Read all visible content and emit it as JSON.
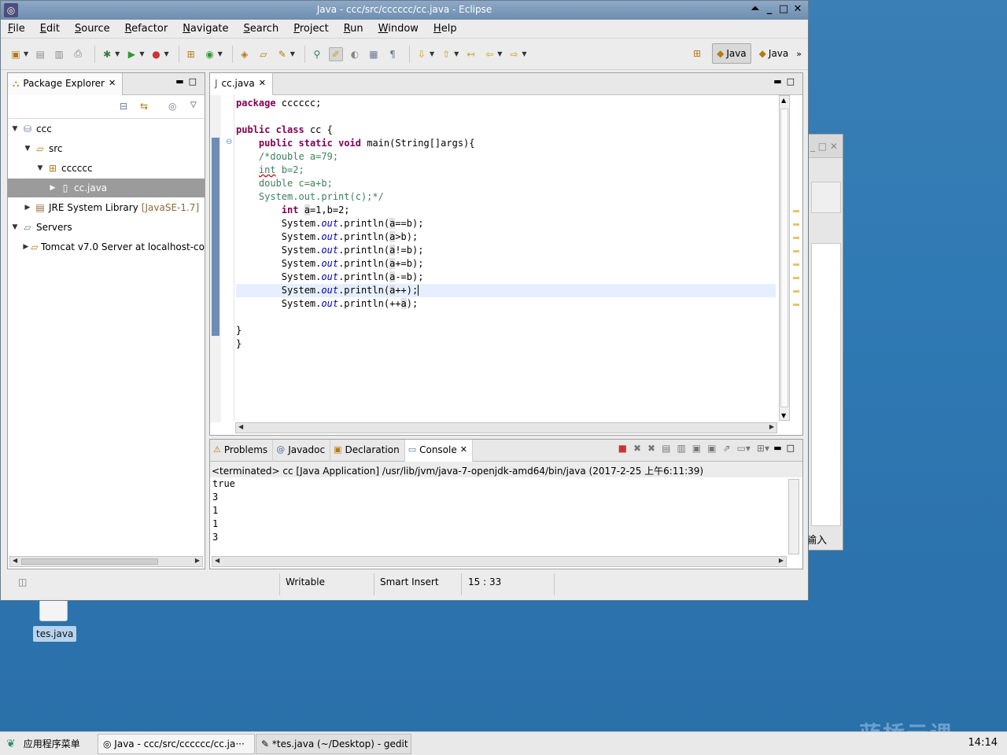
{
  "window": {
    "title": "Java - ccc/src/cccccc/cc.java - Eclipse"
  },
  "menu": [
    "File",
    "Edit",
    "Source",
    "Refactor",
    "Navigate",
    "Search",
    "Project",
    "Run",
    "Window",
    "Help"
  ],
  "perspectives": [
    {
      "label": "Java"
    },
    {
      "label": "Java"
    }
  ],
  "package_explorer": {
    "tab": "Package Explorer",
    "tree": [
      {
        "label": "ccc",
        "extra": "",
        "icon": "project-icon"
      },
      {
        "label": "src",
        "extra": "",
        "icon": "source-folder-icon"
      },
      {
        "label": "cccccc",
        "extra": "",
        "icon": "package-icon"
      },
      {
        "label": "cc.java",
        "extra": "",
        "icon": "java-file-icon"
      },
      {
        "label": "JRE System Library",
        "extra": "[JavaSE-1.7]",
        "icon": "library-icon"
      },
      {
        "label": "Servers",
        "extra": "",
        "icon": "folder-icon"
      },
      {
        "label": "Tomcat v7.0 Server at localhost-co",
        "extra": "",
        "icon": "folder-icon"
      }
    ]
  },
  "editor": {
    "tab": "cc.java",
    "lines": [
      "package cccccc;",
      "",
      "public class cc {",
      "    public static void main(String[]args){",
      "    /*double a=79;",
      "    int b=2;",
      "    double c=a+b;",
      "    System.out.print(c);*/",
      "        int a=1,b=2;",
      "        System.out.println(a==b);",
      "        System.out.println(a>b);",
      "        System.out.println(a!=b);",
      "        System.out.println(a+=b);",
      "        System.out.println(a-=b);",
      "        System.out.println(a++);",
      "        System.out.println(++a);",
      "",
      "}",
      "}"
    ]
  },
  "console": {
    "tabs": [
      "Problems",
      "Javadoc",
      "Declaration",
      "Console"
    ],
    "description": "<terminated> cc [Java Application] /usr/lib/jvm/java-7-openjdk-amd64/bin/java (2017-2-25 上午6:11:39)",
    "output": [
      "true",
      "3",
      "1",
      "1",
      "3"
    ]
  },
  "status": {
    "writable": "Writable",
    "insert_mode": "Smart Insert",
    "position": "15 : 33"
  },
  "desktop": {
    "file_label": "tes.java",
    "bg_window_text": "输入"
  },
  "taskbar": {
    "menu": "应用程序菜单",
    "items": [
      "Java - ccc/src/cccccc/cc.ja···",
      "*tes.java (~/Desktop) - gedit"
    ],
    "clock": "14:14",
    "watermark": "蓝桥云课"
  }
}
